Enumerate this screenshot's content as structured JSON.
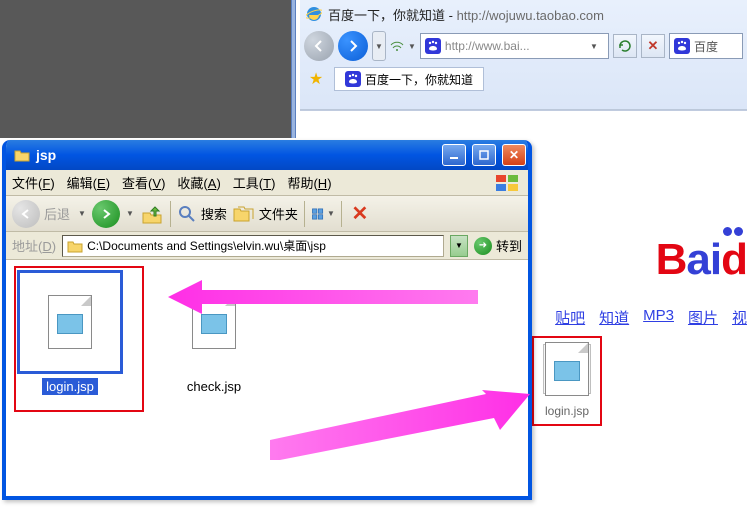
{
  "ie": {
    "title_prefix": "百度一下，你就知道",
    "title_sep": " - ",
    "title_url": "http://wojuwu.taobao.com",
    "address_text": "http://www.bai...",
    "search_box_label": "百度",
    "tab_label": "百度一下，你就知道"
  },
  "baidu": {
    "links": [
      "贴吧",
      "知道",
      "MP3",
      "图片",
      "视"
    ]
  },
  "drop_file": {
    "label": "login.jsp"
  },
  "explorer": {
    "title": "jsp",
    "menu": {
      "file": "文件",
      "file_u": "F",
      "edit": "编辑",
      "edit_u": "E",
      "view": "查看",
      "view_u": "V",
      "fav": "收藏",
      "fav_u": "A",
      "tools": "工具",
      "tools_u": "T",
      "help": "帮助",
      "help_u": "H"
    },
    "toolbar": {
      "back": "后退",
      "search": "搜索",
      "folders": "文件夹"
    },
    "address_label": "地址",
    "address_u": "D",
    "path": "C:\\Documents and Settings\\elvin.wu\\桌面\\jsp",
    "go": "转到"
  },
  "files": [
    {
      "name": "login.jsp",
      "selected": true
    },
    {
      "name": "check.jsp",
      "selected": false
    }
  ]
}
